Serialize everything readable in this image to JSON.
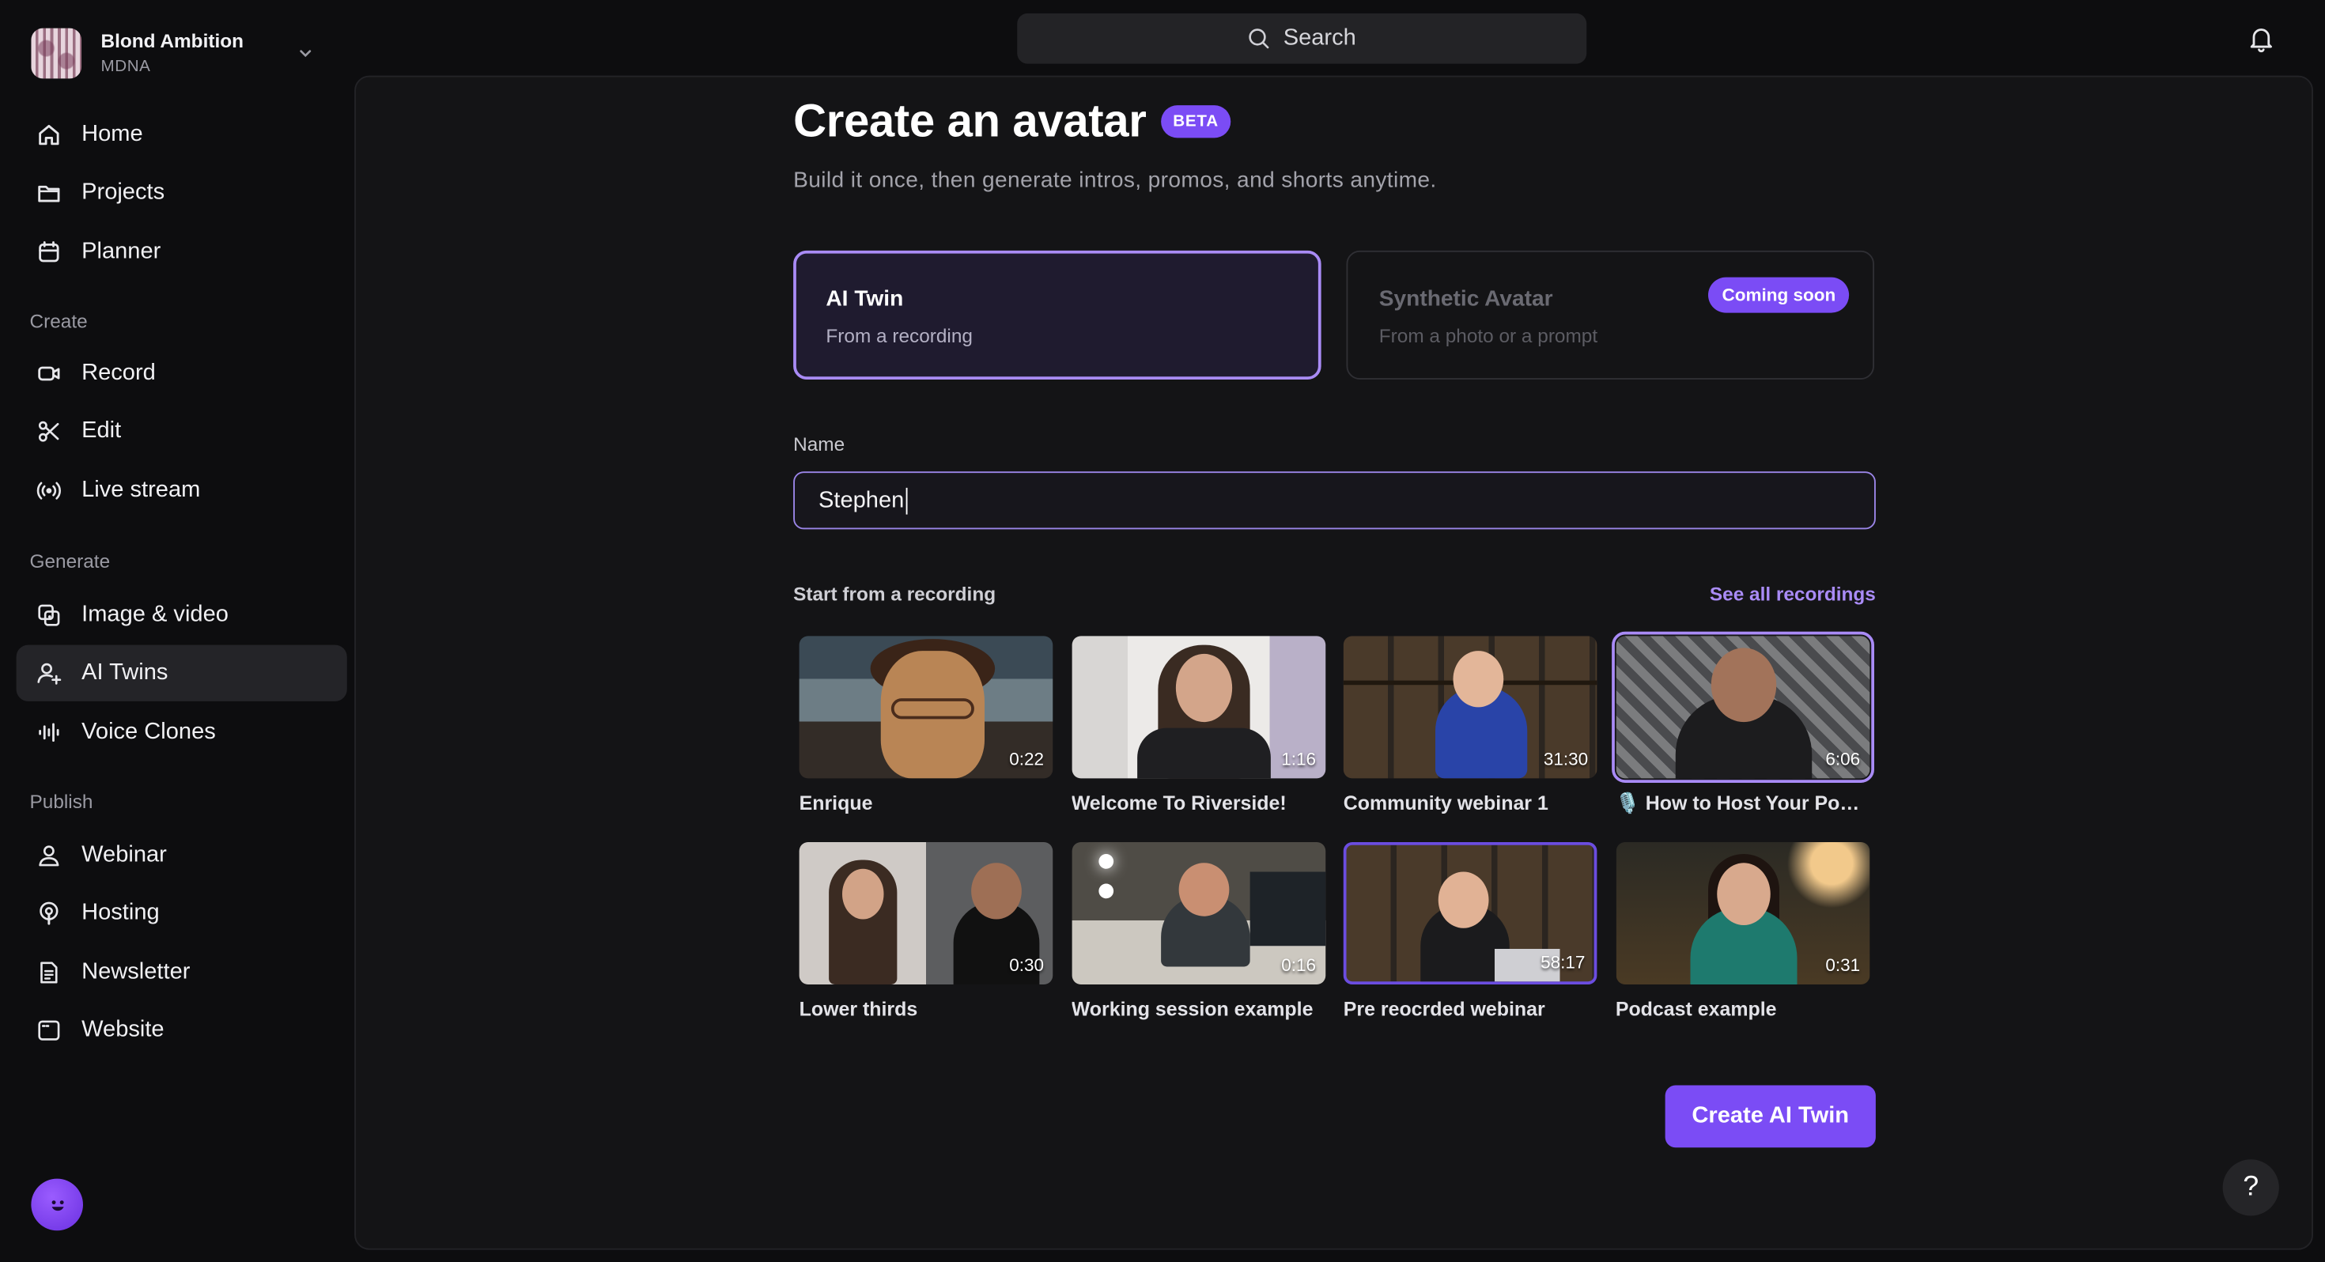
{
  "workspace": {
    "name": "Blond Ambition",
    "subtitle": "MDNA"
  },
  "nav": {
    "top": [
      {
        "label": "Home",
        "icon": "home-icon"
      },
      {
        "label": "Projects",
        "icon": "folder-icon"
      },
      {
        "label": "Planner",
        "icon": "calendar-icon"
      }
    ],
    "sections": [
      {
        "title": "Create",
        "items": [
          {
            "label": "Record",
            "icon": "video-camera-icon"
          },
          {
            "label": "Edit",
            "icon": "scissors-icon"
          },
          {
            "label": "Live stream",
            "icon": "broadcast-icon"
          }
        ]
      },
      {
        "title": "Generate",
        "items": [
          {
            "label": "Image & video",
            "icon": "image-icon"
          },
          {
            "label": "AI Twins",
            "icon": "user-plus-icon",
            "active": true
          },
          {
            "label": "Voice Clones",
            "icon": "waveform-icon"
          }
        ]
      },
      {
        "title": "Publish",
        "items": [
          {
            "label": "Webinar",
            "icon": "user-icon"
          },
          {
            "label": "Hosting",
            "icon": "podcast-icon"
          },
          {
            "label": "Newsletter",
            "icon": "document-icon"
          },
          {
            "label": "Website",
            "icon": "browser-icon"
          }
        ]
      }
    ]
  },
  "search": {
    "placeholder": "Search"
  },
  "page": {
    "title": "Create an avatar",
    "badge": "BETA",
    "subtitle": "Build it once, then generate intros, promos, and shorts anytime."
  },
  "options": {
    "twin": {
      "title": "AI Twin",
      "subtitle": "From a recording"
    },
    "synthetic": {
      "title": "Synthetic Avatar",
      "subtitle": "From a photo or a prompt",
      "badge": "Coming soon"
    }
  },
  "name_field": {
    "label": "Name",
    "value": "Stephen"
  },
  "recordings": {
    "title": "Start from a recording",
    "see_all": "See all recordings",
    "items": [
      {
        "title": "Enrique",
        "duration": "0:22",
        "style": "t-enrique"
      },
      {
        "title": "Welcome To Riverside!",
        "duration": "1:16",
        "style": "t-welcome"
      },
      {
        "title": "Community webinar 1",
        "duration": "31:30",
        "style": "t-community"
      },
      {
        "title": "🎙️ How to Host Your Podcast",
        "duration": "6:06",
        "style": "t-howto",
        "selected": true
      },
      {
        "title": "Lower thirds",
        "duration": "0:30",
        "style": "t-lower"
      },
      {
        "title": "Working session example",
        "duration": "0:16",
        "style": "t-working"
      },
      {
        "title": "Pre reocrded webinar",
        "duration": "58:17",
        "style": "t-pre"
      },
      {
        "title": "Podcast example",
        "duration": "0:31",
        "style": "t-podcast"
      }
    ]
  },
  "actions": {
    "create": "Create AI Twin",
    "help": "?"
  },
  "colors": {
    "accent": "#7b4cf5",
    "accent_light": "#a98bf6",
    "background": "#0d0d0f",
    "panel": "#141416"
  }
}
